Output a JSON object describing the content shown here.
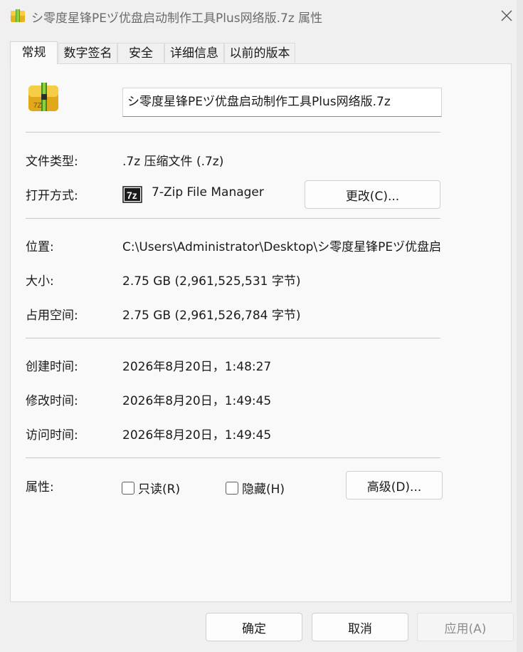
{
  "window": {
    "title": "シ零度星锋PEヅ优盘启动制作工具Plus网络版.7z 属性",
    "close_icon": "close-icon"
  },
  "tabs": [
    {
      "label": "常规"
    },
    {
      "label": "数字签名"
    },
    {
      "label": "安全"
    },
    {
      "label": "详细信息"
    },
    {
      "label": "以前的版本"
    }
  ],
  "general": {
    "file_name": "シ零度星锋PEヅ优盘启动制作工具Plus网络版.7z",
    "file_type_label": "文件类型:",
    "file_type_value": ".7z 压缩文件 (.7z)",
    "open_with_label": "打开方式:",
    "open_with_value": "7-Zip File Manager",
    "open_with_icon_text": "7z",
    "change_button": "更改(C)...",
    "location_label": "位置:",
    "location_value": "C:\\Users\\Administrator\\Desktop\\シ零度星锋PEヅ优盘启",
    "size_label": "大小:",
    "size_value": "2.75 GB (2,961,525,531 字节)",
    "size_on_disk_label": "占用空间:",
    "size_on_disk_value": "2.75 GB (2,961,526,784 字节)",
    "created_label": "创建时间:",
    "created_value": "2026年8月20日，1:48:27",
    "modified_label": "修改时间:",
    "modified_value": "2026年8月20日，1:49:45",
    "accessed_label": "访问时间:",
    "accessed_value": "2026年8月20日，1:49:45",
    "attributes_label": "属性:",
    "readonly_label": "只读(R)",
    "hidden_label": "隐藏(H)",
    "advanced_button": "高级(D)..."
  },
  "footer": {
    "ok": "确定",
    "cancel": "取消",
    "apply": "应用(A)"
  },
  "colors": {
    "archive_yellow": "#f2c230",
    "archive_green": "#4e9a2a",
    "accent": "#1a1a1a"
  }
}
